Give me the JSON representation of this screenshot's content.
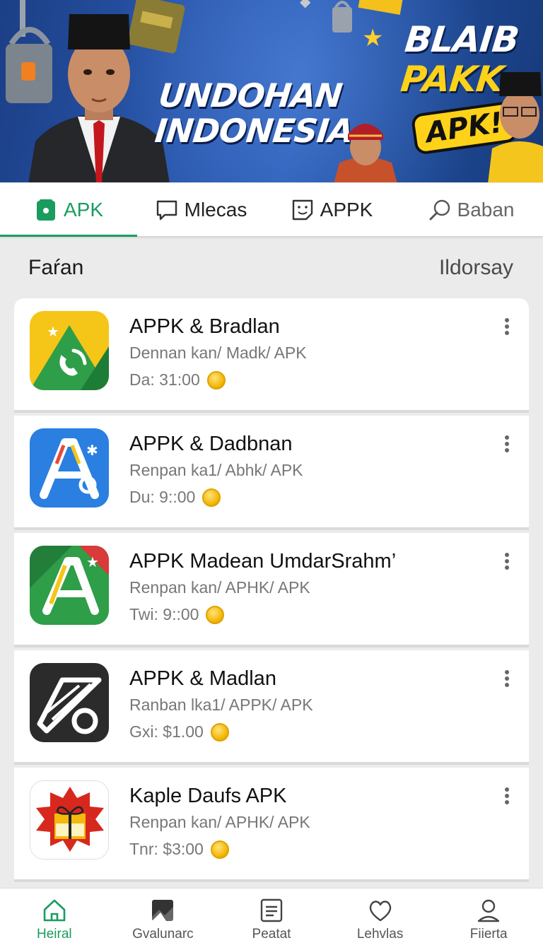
{
  "banner": {
    "headline": [
      "UNDOHAN",
      "INDONESIA"
    ],
    "headline_right": [
      "BLAIB",
      "PAKK."
    ],
    "bubble": "APK!"
  },
  "tabs": [
    {
      "label": "APK",
      "icon": "apk-icon",
      "active": true
    },
    {
      "label": "Mlecas",
      "icon": "chat-icon",
      "active": false
    },
    {
      "label": "APPK",
      "icon": "sticker-icon",
      "active": false
    },
    {
      "label": "Baban",
      "icon": "search-icon",
      "active": false
    }
  ],
  "section": {
    "title": "Faŕan",
    "link": "Ildorsay"
  },
  "apps": [
    {
      "name": "APPK & Bradlan",
      "sub": "Dennan kan/ Madk/ APK",
      "meta": "Da: 31:00",
      "icon": "phone-app-icon"
    },
    {
      "name": "APPK & Dadbnan",
      "sub": "Renpan ka1/ Abhk/ APK",
      "meta": "Du: 9::00",
      "icon": "letter-a-app-icon"
    },
    {
      "name": "APPK Madean UmdarSrahm’",
      "sub": "Renpan kan/ APHK/ APK",
      "meta": "Twi: 9::00",
      "icon": "green-a-app-icon"
    },
    {
      "name": "APPK & Madlan",
      "sub": "Ranban lka1/ APPK/ APK",
      "meta": "Gxi: $1.00",
      "icon": "ruler-app-icon"
    },
    {
      "name": "Kaple Daufs APK",
      "sub": "Renpan kan/ APHK/ APK",
      "meta": "Tnr: $3:00",
      "icon": "gift-app-icon"
    }
  ],
  "bottom_nav": [
    {
      "label": "Heiral",
      "icon": "home-icon",
      "active": true
    },
    {
      "label": "Gvalunarc",
      "icon": "gallery-icon",
      "active": false
    },
    {
      "label": "Peatat",
      "icon": "document-icon",
      "active": false
    },
    {
      "label": "Lehvlas",
      "icon": "heart-icon",
      "active": false
    },
    {
      "label": "Fiierta",
      "icon": "profile-icon",
      "active": false
    }
  ],
  "colors": {
    "accent": "#1a9c5f",
    "banner": "#2856ac",
    "highlight": "#ffd21a"
  }
}
